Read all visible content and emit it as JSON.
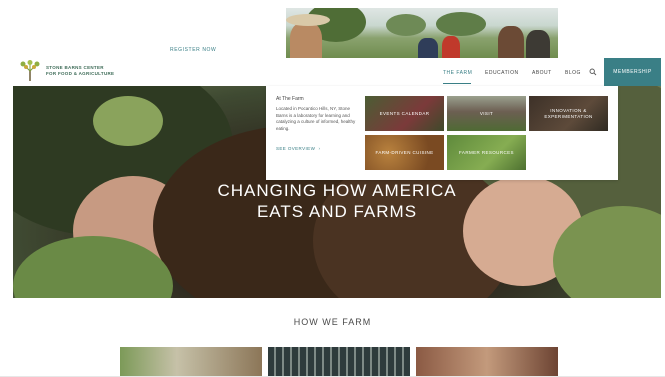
{
  "header": {
    "register_label": "REGISTER NOW",
    "logo_lines": [
      "STONE BARNS CENTER",
      "FOR FOOD & AGRICULTURE"
    ],
    "nav": [
      {
        "label": "THE FARM",
        "active": true
      },
      {
        "label": "EDUCATION",
        "active": false
      },
      {
        "label": "ABOUT",
        "active": false
      },
      {
        "label": "BLOG",
        "active": false
      }
    ],
    "membership_label": "MEMBERSHIP",
    "search_icon": "search-icon",
    "accent_color": "#3a7f86"
  },
  "dropdown": {
    "heading": "At The Farm",
    "description": "Located in Pocantico Hills, NY, Stone Barns is a laboratory for learning and catalyzing a culture of informed, healthy eating.",
    "link": "SEE OVERVIEW",
    "tiles": [
      {
        "label": "EVENTS CALENDAR"
      },
      {
        "label": "VISIT"
      },
      {
        "label": "INNOVATION & EXPERIMENTATION"
      },
      {
        "label": "FARM-DRIVEN CUISINE"
      },
      {
        "label": "FARMER RESOURCES"
      }
    ]
  },
  "hero": {
    "title_line1": "CHANGING HOW AMERICA",
    "title_line2": "EATS AND FARMS"
  },
  "section": {
    "title": "HOW WE FARM"
  }
}
